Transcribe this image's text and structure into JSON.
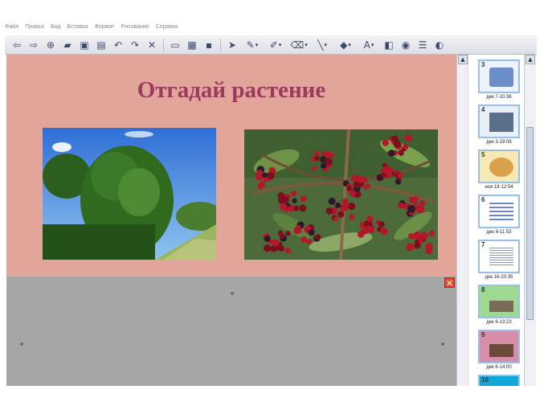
{
  "menu": [
    "Файл",
    "Правка",
    "Вид",
    "Вставка",
    "Формат",
    "Рисование",
    "Справка"
  ],
  "toolbar": {
    "buttons": [
      {
        "name": "back-icon",
        "glyph": "⇦"
      },
      {
        "name": "forward-icon",
        "glyph": "⇨"
      },
      {
        "name": "add-page-icon",
        "glyph": "⊕"
      },
      {
        "name": "open-folder-icon",
        "glyph": "▰"
      },
      {
        "name": "save-icon",
        "glyph": "▣"
      },
      {
        "name": "paste-icon",
        "glyph": "▤"
      },
      {
        "name": "undo-icon",
        "glyph": "↶"
      },
      {
        "name": "redo-icon",
        "glyph": "↷"
      },
      {
        "name": "delete-icon",
        "glyph": "✕"
      },
      {
        "name": "screen-shade-icon",
        "glyph": "▭"
      },
      {
        "name": "full-screen-icon",
        "glyph": "▦"
      },
      {
        "name": "camera-icon",
        "glyph": "▪"
      },
      {
        "name": "select-arrow-icon",
        "glyph": "➤"
      },
      {
        "name": "pen-icon",
        "glyph": "✎",
        "drop": true
      },
      {
        "name": "creative-pen-icon",
        "glyph": "✐",
        "drop": true
      },
      {
        "name": "eraser-icon",
        "glyph": "⌫",
        "drop": true
      },
      {
        "name": "line-icon",
        "glyph": "╲",
        "drop": true
      },
      {
        "name": "fill-icon",
        "glyph": "◆",
        "drop": true
      },
      {
        "name": "text-icon",
        "glyph": "A",
        "drop": true
      },
      {
        "name": "shapes-icon",
        "glyph": "◧"
      },
      {
        "name": "magic-pen-icon",
        "glyph": "◉"
      },
      {
        "name": "menu-icon",
        "glyph": "☰"
      },
      {
        "name": "toolbar-toggle-icon",
        "glyph": "◐"
      }
    ]
  },
  "slide": {
    "title": "Отгадай  растение"
  },
  "thumbnails": [
    {
      "num": "3",
      "label": "дек 7-10:36"
    },
    {
      "num": "4",
      "label": "дек 3-19:08"
    },
    {
      "num": "5",
      "label": "ноя 18-12:54"
    },
    {
      "num": "6",
      "label": "дек 6-11:53"
    },
    {
      "num": "7",
      "label": "дек 16-20:35"
    },
    {
      "num": "8",
      "label": "дек 6-13:23"
    },
    {
      "num": "9",
      "label": "дек 6-14:00"
    },
    {
      "num": "10",
      "label": ""
    }
  ],
  "close_glyph": "✕",
  "colors": {
    "slide_bg": "#e2a599",
    "title": "#9b3a5e",
    "canvas_bg": "#a6a6a6"
  }
}
